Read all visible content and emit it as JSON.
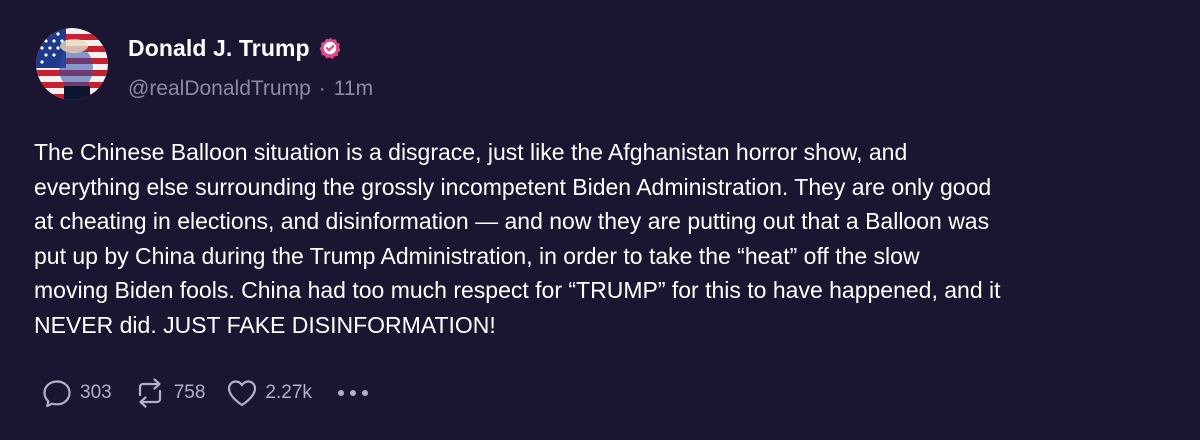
{
  "author": {
    "display_name": "Donald J. Trump",
    "handle": "@realDonaldTrump",
    "separator": "·",
    "time_ago": "11m"
  },
  "post": {
    "text": "The Chinese Balloon situation is a disgrace, just like the Afghanistan horror show, and\neverything else surrounding the grossly incompetent Biden Administration. They are only good\nat cheating in elections, and disinformation — and now they are putting out that a Balloon was\nput up by China during the Trump Administration, in order to take the “heat” off the slow\nmoving Biden fools. China had too much respect for “TRUMP” for this to have happened, and it\nNEVER did. JUST FAKE DISINFORMATION!"
  },
  "actions": {
    "replies": "303",
    "retruths": "758",
    "likes": "2.27k"
  },
  "icons": {
    "reply": "speech-bubble-icon",
    "retruth": "repost-arrows-icon",
    "like": "heart-icon",
    "more": "ellipsis-icon",
    "verified": "verified-badge-icon"
  },
  "colors": {
    "background": "#1a1530",
    "verified_badge": "#e0468a",
    "muted_text": "#8e8aa3",
    "action_text": "#b3afc5"
  }
}
